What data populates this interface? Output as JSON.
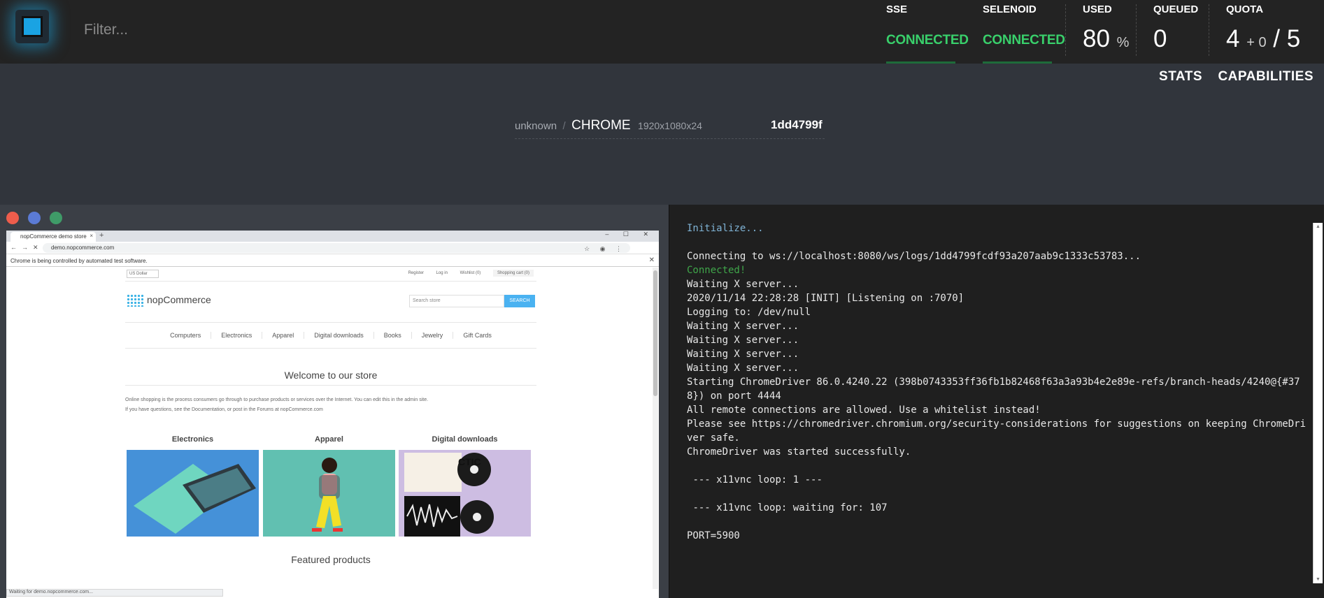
{
  "header": {
    "filter_placeholder": "Filter...",
    "stats": {
      "sse": {
        "label": "SSE",
        "status": "CONNECTED"
      },
      "selenoid": {
        "label": "SELENOID",
        "status": "CONNECTED"
      },
      "used": {
        "label": "USED",
        "value": "80",
        "unit": "%"
      },
      "queued": {
        "label": "QUEUED",
        "value": "0"
      },
      "quota": {
        "label": "QUOTA",
        "value": "4",
        "plus": "+ 0",
        "total": "/ 5"
      }
    },
    "status_color": "#39d06b",
    "accent_color": "#1aa3e3"
  },
  "tabs": [
    {
      "label": "STATS"
    },
    {
      "label": "CAPABILITIES"
    }
  ],
  "session": {
    "manufacturer": "unknown",
    "separator": "/",
    "browser": "CHROME",
    "resolution": "1920x1080x24",
    "id": "1dd4799f"
  },
  "vnc": {
    "window_controls": [
      "close",
      "minimize",
      "maximize"
    ],
    "browser": {
      "tab_title": "nopCommerce demo store",
      "tab_close": "×",
      "new_tab": "+",
      "window_buttons": "– ☐ ✕",
      "url": "demo.nopcommerce.com",
      "info_bar": "Chrome is being controlled by automated test software.",
      "info_close": "✕",
      "status_text": "Waiting for demo.nopcommerce.com..."
    },
    "site": {
      "currency": "US Dollar",
      "header_links": [
        "Register",
        "Log in",
        "Wishlist (0)",
        "Shopping cart (0)"
      ],
      "logo": "nopCommerce",
      "search_placeholder": "Search store",
      "search_button": "SEARCH",
      "menu": [
        "Computers",
        "Electronics",
        "Apparel",
        "Digital downloads",
        "Books",
        "Jewelry",
        "Gift Cards"
      ],
      "welcome_title": "Welcome to our store",
      "welcome_p1": "Online shopping is the process consumers go through to purchase products or services over the Internet. You can edit this in the admin site.",
      "welcome_p2": "If you have questions, see the Documentation, or post in the Forums at nopCommerce.com",
      "categories": [
        {
          "title": "Electronics"
        },
        {
          "title": "Apparel"
        },
        {
          "title": "Digital downloads"
        }
      ],
      "featured_title": "Featured products"
    }
  },
  "log": {
    "lines": [
      {
        "text": "Initialize...",
        "kind": "init"
      },
      {
        "text": "",
        "kind": "plain"
      },
      {
        "text": "Connecting to ws://localhost:8080/ws/logs/1dd4799fcdf93a207aab9c1333c53783...",
        "kind": "plain"
      },
      {
        "text": "Connected!",
        "kind": "ok"
      },
      {
        "text": "Waiting X server...",
        "kind": "plain"
      },
      {
        "text": "2020/11/14 22:28:28 [INIT] [Listening on :7070]",
        "kind": "plain"
      },
      {
        "text": "Logging to: /dev/null",
        "kind": "plain"
      },
      {
        "text": "Waiting X server...",
        "kind": "plain"
      },
      {
        "text": "Waiting X server...",
        "kind": "plain"
      },
      {
        "text": "Waiting X server...",
        "kind": "plain"
      },
      {
        "text": "Waiting X server...",
        "kind": "plain"
      },
      {
        "text": "Starting ChromeDriver 86.0.4240.22 (398b0743353ff36fb1b82468f63a3a93b4e2e89e-refs/branch-heads/4240@{#378}) on port 4444",
        "kind": "plain"
      },
      {
        "text": "All remote connections are allowed. Use a whitelist instead!",
        "kind": "plain"
      },
      {
        "text": "Please see https://chromedriver.chromium.org/security-considerations for suggestions on keeping ChromeDriver safe.",
        "kind": "plain"
      },
      {
        "text": "ChromeDriver was started successfully.",
        "kind": "plain"
      },
      {
        "text": "",
        "kind": "plain"
      },
      {
        "text": " --- x11vnc loop: 1 ---",
        "kind": "plain"
      },
      {
        "text": "",
        "kind": "plain"
      },
      {
        "text": " --- x11vnc loop: waiting for: 107",
        "kind": "plain"
      },
      {
        "text": "",
        "kind": "plain"
      },
      {
        "text": "PORT=5900",
        "kind": "plain"
      }
    ]
  }
}
